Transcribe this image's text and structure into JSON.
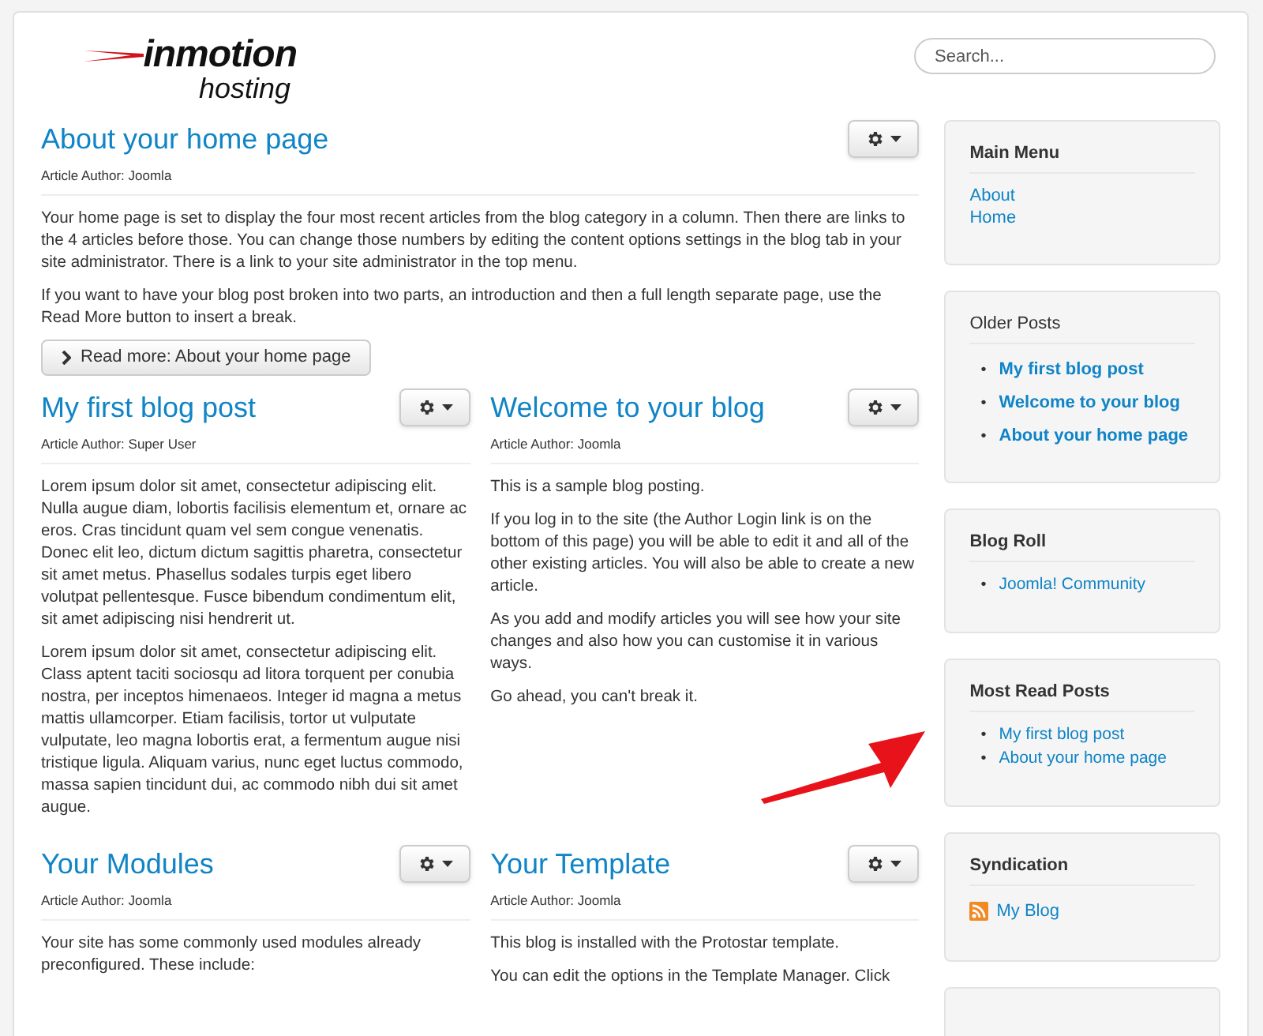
{
  "logo": {
    "brand": "inmotion",
    "sub": "hosting"
  },
  "search": {
    "placeholder": "Search..."
  },
  "lead_article": {
    "title": "About your home page",
    "author": "Article Author: Joomla",
    "paragraphs": [
      "Your home page is set to display the four most recent articles from the blog category in a column. Then there are links to the 4 articles before those. You can change those numbers by editing the content options settings in the blog tab in your site administrator. There is a link to your site administrator in the top menu.",
      "If you want to have your blog post broken into two parts, an introduction and then a full length separate page, use the Read More button to insert a break."
    ],
    "read_more": "Read more: About your home page"
  },
  "articles": [
    {
      "title": "My first blog post",
      "author": "Article Author: Super User",
      "paragraphs": [
        "Lorem ipsum dolor sit amet, consectetur adipiscing elit. Nulla augue diam, lobortis facilisis elementum et, ornare ac eros. Cras tincidunt quam vel sem congue venenatis. Donec elit leo, dictum dictum sagittis pharetra, consectetur sit amet metus. Phasellus sodales turpis eget libero volutpat pellentesque. Fusce bibendum condimentum elit, sit amet adipiscing nisi hendrerit ut.",
        "Lorem ipsum dolor sit amet, consectetur adipiscing elit. Class aptent taciti sociosqu ad litora torquent per conubia nostra, per inceptos himenaeos. Integer id magna a metus mattis ullamcorper. Etiam facilisis, tortor ut vulputate vulputate, leo magna lobortis erat, a fermentum augue nisi tristique ligula. Aliquam varius, nunc eget luctus commodo, massa sapien tincidunt dui, ac commodo nibh dui sit amet augue."
      ]
    },
    {
      "title": "Welcome to your blog",
      "author": "Article Author: Joomla",
      "paragraphs": [
        "This is a sample blog posting.",
        "If you log in to the site (the Author Login link is on the bottom of this page) you will be able to edit it and all of the other existing articles. You will also be able to create a new article.",
        "As you add and modify articles you will see how your site changes and also how you can customise it in various ways.",
        "Go ahead, you can't break it."
      ]
    },
    {
      "title": "Your Modules",
      "author": "Article Author: Joomla",
      "paragraphs": [
        "Your site has some commonly used modules already preconfigured. These include:"
      ]
    },
    {
      "title": "Your Template",
      "author": "Article Author: Joomla",
      "paragraphs": [
        "This blog is installed with the Protostar template.",
        "You can edit the options in the Template Manager. Click"
      ]
    }
  ],
  "sidebar": [
    {
      "kind": "menu",
      "title": "Main Menu",
      "items": [
        "About",
        "Home"
      ]
    },
    {
      "kind": "featured",
      "title": "Older Posts",
      "marker": "•",
      "items": [
        "My first blog post",
        "Welcome to your blog",
        "About your home page"
      ]
    },
    {
      "kind": "bullets",
      "title": "Blog Roll",
      "marker": "•",
      "items": [
        "Joomla! Community"
      ]
    },
    {
      "kind": "bullets",
      "title": "Most Read Posts",
      "marker": "•",
      "items": [
        "My first blog post",
        "About your home page"
      ]
    },
    {
      "kind": "feed",
      "title": "Syndication",
      "items": [
        "My Blog"
      ]
    },
    {
      "kind": "empty"
    }
  ]
}
